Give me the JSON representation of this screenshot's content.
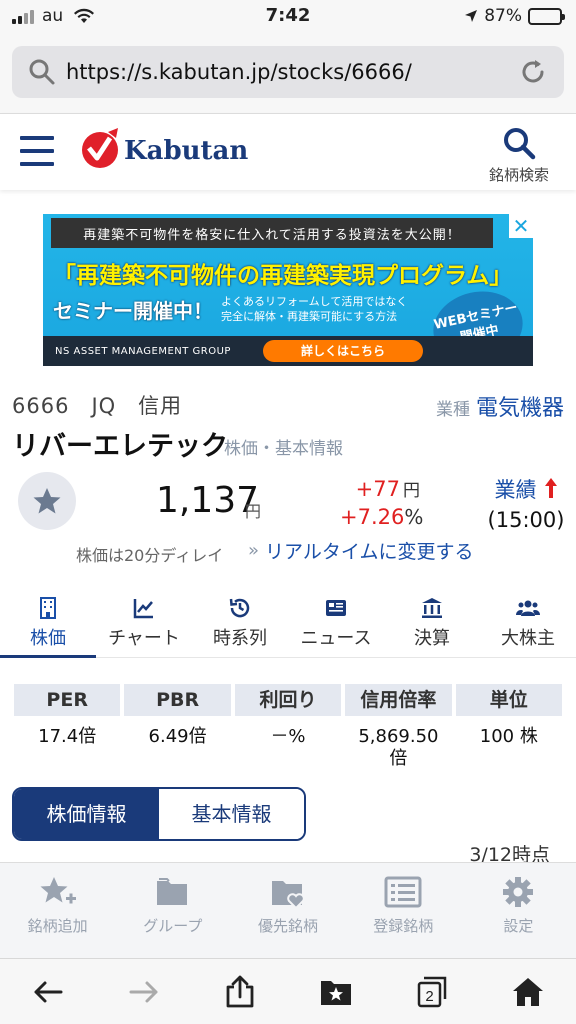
{
  "status_bar": {
    "carrier": "au",
    "time": "7:42",
    "battery": "87%",
    "battery_level": 0.87
  },
  "browser": {
    "url": "https://s.kabutan.jp/stocks/6666/"
  },
  "site": {
    "logo_text": "Kabutan",
    "search_label": "銘柄検索"
  },
  "ad": {
    "top": "再建築不可物件を格安に仕入れて活用する投資法を大公開！",
    "headline": "「再建築不可物件の再建築実現プログラム」",
    "seminar": "セミナー開催中！",
    "small_line1": "よくあるリフォームして活用ではなく",
    "small_line2": "完全に解体・再建築可能にする方法",
    "badge_line1": "WEBセミナー",
    "badge_line2": "開催中",
    "company": "NS ASSET MANAGEMENT GROUP",
    "cta": "詳しくはこちら",
    "close": "✕"
  },
  "stock": {
    "code_row": "6666　JQ　信用",
    "sector_label": "業種",
    "sector": "電気機器",
    "name": "リバーエレテック",
    "name_sub": "株価・基本情報",
    "price": "1,137",
    "price_unit": "円",
    "change_abs": "+77",
    "change_abs_unit": "円",
    "change_pct": "+7.26",
    "change_pct_unit": "%",
    "perf_label": "業績",
    "perf_time": "(15:00)",
    "delay_note": "株価は20分ディレイ",
    "realtime_link": "リアルタイムに変更する",
    "realtime_chev": "»"
  },
  "tabs": [
    {
      "label": "株価",
      "icon": "building-icon",
      "active": true
    },
    {
      "label": "チャート",
      "icon": "chart-icon",
      "active": false
    },
    {
      "label": "時系列",
      "icon": "history-icon",
      "active": false
    },
    {
      "label": "ニュース",
      "icon": "news-icon",
      "active": false
    },
    {
      "label": "決算",
      "icon": "bank-icon",
      "active": false
    },
    {
      "label": "大株主",
      "icon": "people-icon",
      "active": false
    }
  ],
  "metrics": {
    "headers": [
      "PER",
      "PBR",
      "利回り",
      "信用倍率",
      "単位"
    ],
    "values": [
      "17.4倍",
      "6.49倍",
      "－%",
      "5,869.50\n倍",
      "100 株"
    ]
  },
  "toggle": {
    "left": "株価情報",
    "right": "基本情報"
  },
  "as_of": "3/12時点",
  "app_nav": [
    {
      "label": "銘柄追加",
      "icon": "star-plus-icon"
    },
    {
      "label": "グループ",
      "icon": "folder-icon"
    },
    {
      "label": "優先銘柄",
      "icon": "folder-heart-icon"
    },
    {
      "label": "登録銘柄",
      "icon": "list-icon"
    },
    {
      "label": "設定",
      "icon": "gear-icon"
    }
  ],
  "toolbar": {
    "tabs_count": "2"
  },
  "colors": {
    "brand_navy": "#1a3a7a",
    "link_blue": "#1a4fa8",
    "up_red": "#e02020",
    "ad_blue": "#1aa6df"
  }
}
